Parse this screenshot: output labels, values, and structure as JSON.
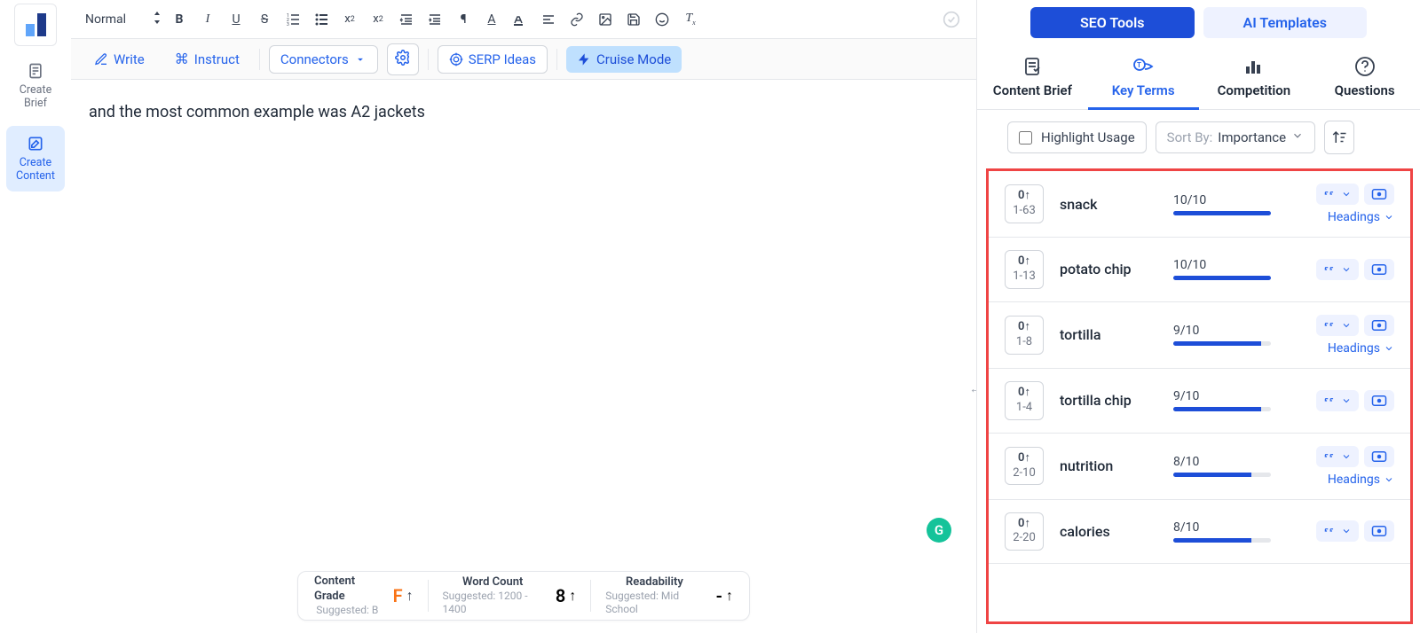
{
  "leftnav": {
    "create_brief": "Create\nBrief",
    "create_content": "Create\nContent"
  },
  "toolbar1": {
    "format": "Normal"
  },
  "toolbar2": {
    "write": "Write",
    "instruct": "Instruct",
    "connectors": "Connectors",
    "serp_ideas": "SERP Ideas",
    "cruise_mode": "Cruise Mode"
  },
  "editor": {
    "text": "and the most common example was A2 jackets"
  },
  "grammarly": "G",
  "status": {
    "grade_label": "Content Grade",
    "grade_sub": "Suggested: B",
    "grade_val": "F",
    "word_label": "Word Count",
    "word_sub": "Suggested: 1200 - 1400",
    "word_val": "8",
    "read_label": "Readability",
    "read_sub": "Suggested: Mid School",
    "read_val": "-"
  },
  "right": {
    "tab_seo": "SEO Tools",
    "tab_ai": "AI Templates",
    "sub": {
      "brief": "Content Brief",
      "key": "Key Terms",
      "comp": "Competition",
      "q": "Questions"
    },
    "highlight": "Highlight Usage",
    "sort_label": "Sort By:",
    "sort_val": "Importance",
    "headings": "Headings",
    "terms": [
      {
        "count": "0↑",
        "range": "1-63",
        "name": "snack",
        "score": "10/10",
        "pct": 100,
        "showHeadings": true
      },
      {
        "count": "0↑",
        "range": "1-13",
        "name": "potato chip",
        "score": "10/10",
        "pct": 100,
        "showHeadings": false
      },
      {
        "count": "0↑",
        "range": "1-8",
        "name": "tortilla",
        "score": "9/10",
        "pct": 90,
        "showHeadings": true
      },
      {
        "count": "0↑",
        "range": "1-4",
        "name": "tortilla chip",
        "score": "9/10",
        "pct": 90,
        "showHeadings": false
      },
      {
        "count": "0↑",
        "range": "2-10",
        "name": "nutrition",
        "score": "8/10",
        "pct": 80,
        "showHeadings": true
      },
      {
        "count": "0↑",
        "range": "2-20",
        "name": "calories",
        "score": "8/10",
        "pct": 80,
        "showHeadings": false
      }
    ]
  }
}
